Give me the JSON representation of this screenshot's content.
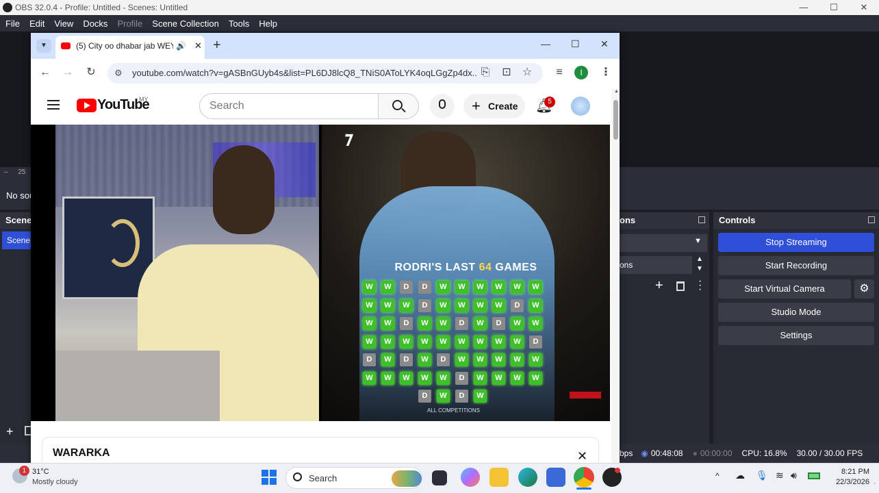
{
  "obs": {
    "title": "OBS 32.0.4 - Profile: Untitled - Scenes: Untitled",
    "menu": [
      "File",
      "Edit",
      "View",
      "Docks",
      "Profile",
      "Scene Collection",
      "Tools",
      "Help"
    ],
    "left_fragments": {
      "zoom": "25",
      "no_source": "No sou",
      "scenes_head": "Scene",
      "scene_item": "Scene"
    },
    "transitions_head": "ons",
    "transitions_label": "ons",
    "controls": {
      "title": "Controls",
      "stop_streaming": "Stop Streaming",
      "start_recording": "Start Recording",
      "start_virtual_camera": "Start Virtual Camera",
      "studio_mode": "Studio Mode",
      "settings": "Settings"
    },
    "status": {
      "bitrate": "bps",
      "stream_time": "00:48:08",
      "rec_time": "00:00:00",
      "cpu": "CPU: 16.8%",
      "fps": "30.00 / 30.00 FPS"
    }
  },
  "chrome": {
    "tab_title": "(5) City oo dhabar jab WEYN",
    "url": "youtube.com/watch?v=gASBnGUyb4s&list=PL6DJ8lcQ8_TNiS0AToLYK4oqLGgZp4dx...",
    "profile_initial": "I"
  },
  "youtube": {
    "logo_text": "YouTube",
    "region": "MY",
    "search_placeholder": "Search",
    "create_label": "Create",
    "notification_count": "5",
    "video_overlay": {
      "headline_prefix": "RODRI'S LAST ",
      "headline_number": "64",
      "headline_suffix": " GAMES",
      "footer": "ALL COMPETITIONS",
      "results_rows": [
        [
          "W",
          "W",
          "D",
          "D",
          "W",
          "W",
          "W",
          "W",
          "W",
          "W"
        ],
        [
          "W",
          "W",
          "W",
          "D",
          "W",
          "W",
          "W",
          "W",
          "D",
          "W"
        ],
        [
          "W",
          "W",
          "D",
          "W",
          "W",
          "D",
          "W",
          "D",
          "W",
          "W"
        ],
        [
          "W",
          "W",
          "W",
          "W",
          "W",
          "W",
          "W",
          "W",
          "W",
          "D"
        ],
        [
          "D",
          "W",
          "D",
          "W",
          "D",
          "W",
          "W",
          "W",
          "W",
          "W"
        ],
        [
          "W",
          "W",
          "W",
          "W",
          "W",
          "D",
          "W",
          "W",
          "W",
          "W"
        ],
        [
          "D",
          "W",
          "D",
          "W"
        ]
      ]
    },
    "description_title": "WARARKA"
  },
  "taskbar": {
    "weather_temp": "31°C",
    "weather_desc": "Mostly cloudy",
    "weather_badge": "1",
    "search_label": "Search",
    "time": "8:21 PM",
    "date": "22/3/2026"
  }
}
